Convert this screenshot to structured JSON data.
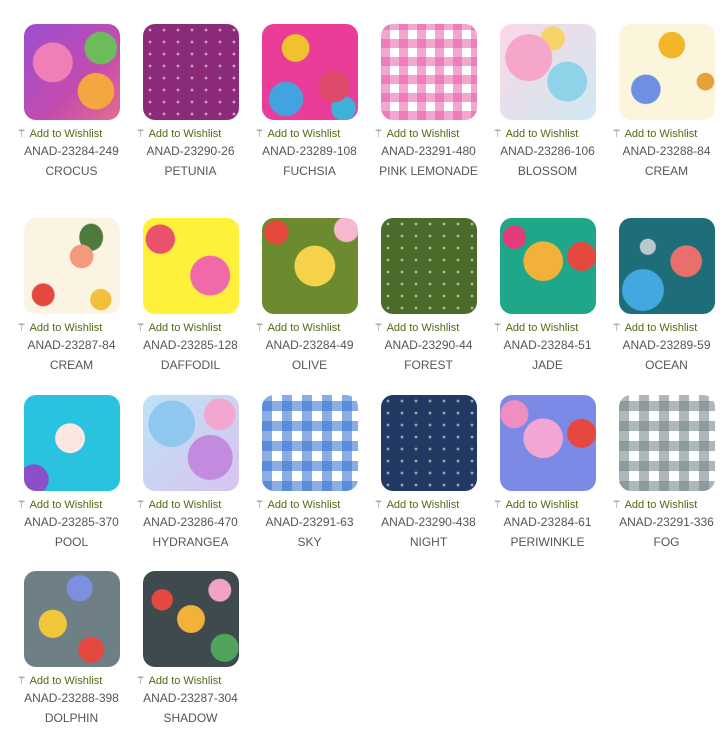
{
  "wishlist_label": "Add to Wishlist",
  "wishlist_icon": "magic-wand-icon",
  "items": [
    {
      "code": "ANAD-23284-249",
      "name": "CROCUS"
    },
    {
      "code": "ANAD-23290-26",
      "name": "PETUNIA"
    },
    {
      "code": "ANAD-23289-108",
      "name": "FUCHSIA"
    },
    {
      "code": "ANAD-23291-480",
      "name": "PINK LEMONADE"
    },
    {
      "code": "ANAD-23286-106",
      "name": "BLOSSOM"
    },
    {
      "code": "ANAD-23288-84",
      "name": "CREAM"
    },
    {
      "code": "ANAD-23287-84",
      "name": "CREAM"
    },
    {
      "code": "ANAD-23285-128",
      "name": "DAFFODIL"
    },
    {
      "code": "ANAD-23284-49",
      "name": "OLIVE"
    },
    {
      "code": "ANAD-23290-44",
      "name": "FOREST"
    },
    {
      "code": "ANAD-23284-51",
      "name": "JADE"
    },
    {
      "code": "ANAD-23289-59",
      "name": "OCEAN"
    },
    {
      "code": "ANAD-23285-370",
      "name": "POOL"
    },
    {
      "code": "ANAD-23286-470",
      "name": "HYDRANGEA"
    },
    {
      "code": "ANAD-23291-63",
      "name": "SKY"
    },
    {
      "code": "ANAD-23290-438",
      "name": "NIGHT"
    },
    {
      "code": "ANAD-23284-61",
      "name": "PERIWINKLE"
    },
    {
      "code": "ANAD-23291-336",
      "name": "FOG"
    },
    {
      "code": "ANAD-23288-398",
      "name": "DOLPHIN"
    },
    {
      "code": "ANAD-23287-304",
      "name": "SHADOW"
    }
  ]
}
